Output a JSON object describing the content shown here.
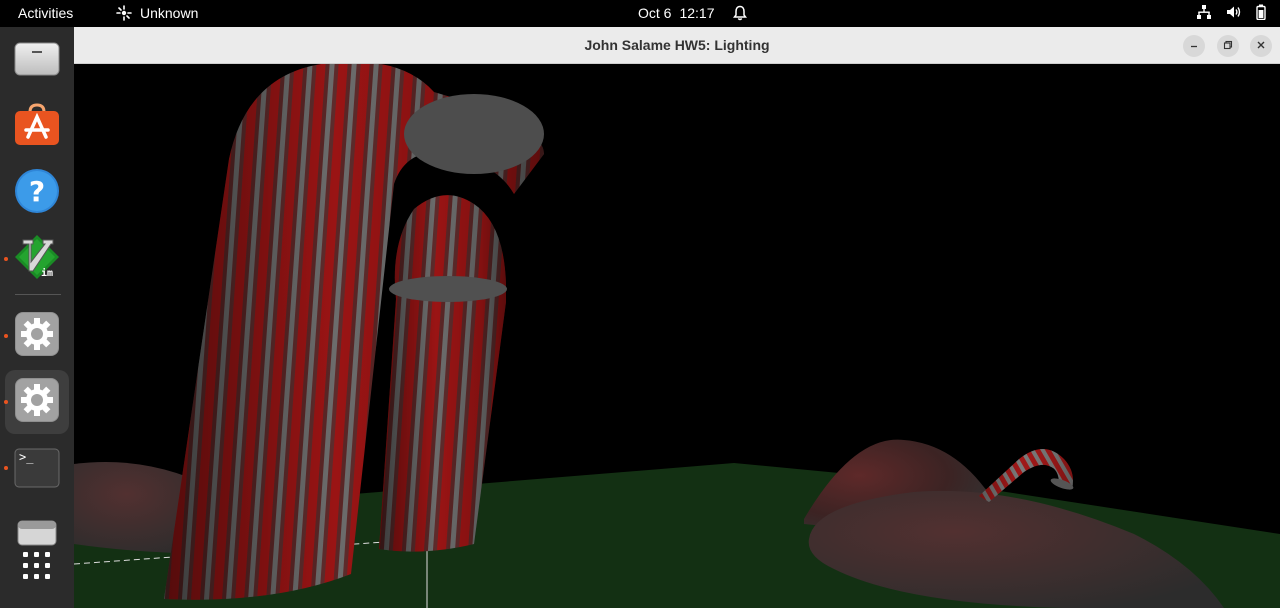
{
  "topbar": {
    "activities_label": "Activities",
    "app_name": "Unknown",
    "date": "Oct 6",
    "time": "12:17"
  },
  "dock": {
    "items": [
      {
        "name": "files",
        "icon": "drive-icon"
      },
      {
        "name": "software",
        "icon": "app-store-icon"
      },
      {
        "name": "help",
        "icon": "help-icon"
      },
      {
        "name": "vim",
        "icon": "vim-icon",
        "running": true
      },
      {
        "name": "settings-1",
        "icon": "gear-icon",
        "running": true
      },
      {
        "name": "settings-2",
        "icon": "gear-icon",
        "running": true,
        "active": true
      },
      {
        "name": "terminal",
        "icon": "terminal-icon",
        "running": true
      },
      {
        "name": "drive",
        "icon": "drive-icon"
      },
      {
        "name": "show-apps",
        "icon": "grid-icon"
      }
    ],
    "terminal_prompt": ">_"
  },
  "window": {
    "title": "John Salame HW5: Lighting"
  },
  "colors": {
    "accent": "#e95420",
    "ground": "#133013",
    "candy_red": "#b01010",
    "candy_gray": "#6a6a6a",
    "mound": "#4a2222"
  }
}
